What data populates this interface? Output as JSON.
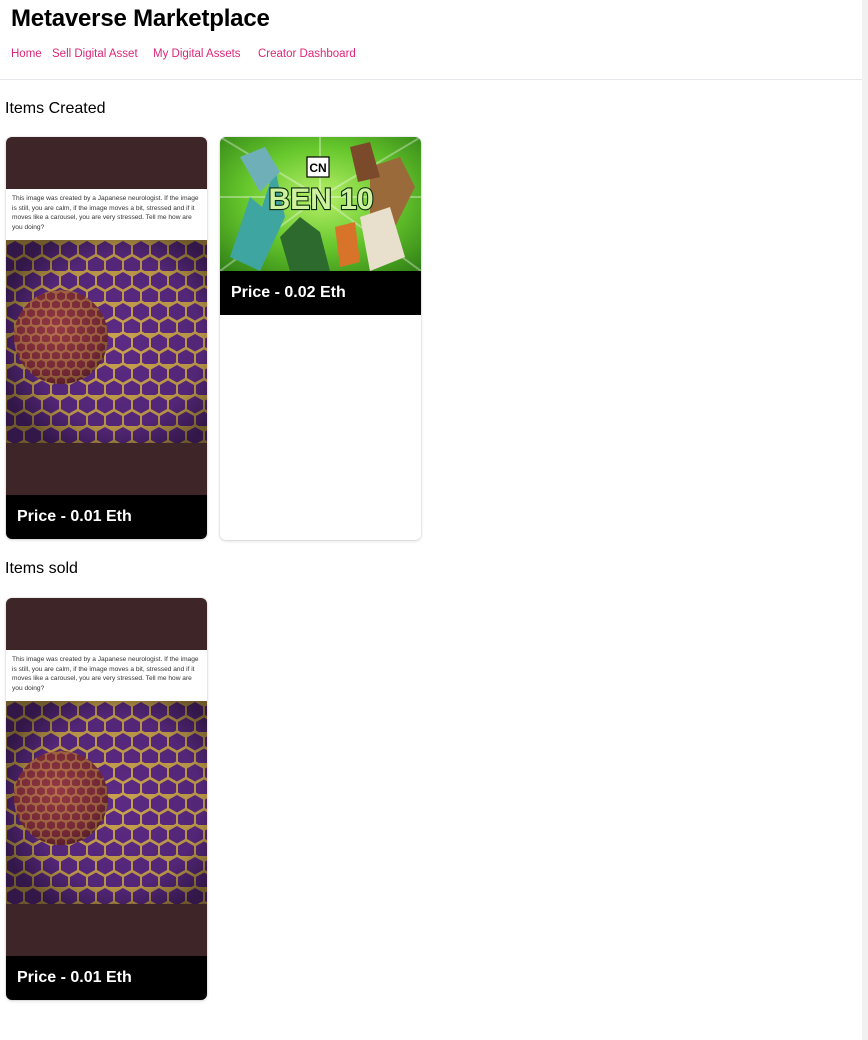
{
  "app": {
    "title": "Metaverse Marketplace",
    "nav": [
      {
        "label": "Home"
      },
      {
        "label": "Sell Digital Asset"
      },
      {
        "label": "My Digital Assets"
      },
      {
        "label": "Creator Dashboard"
      }
    ]
  },
  "sections": {
    "created": {
      "title": "Items Created",
      "items": [
        {
          "price_label": "Price - 0.01 Eth",
          "image_caption": "This image was created by a Japanese neurologist. If the image is still, you are calm, if the image moves a bit, stressed and if it moves like a carousel, you are very stressed. Tell me how are you doing?"
        },
        {
          "price_label": "Price - 0.02 Eth",
          "logo_top": "CN",
          "logo_main": "BEN 10"
        }
      ]
    },
    "sold": {
      "title": "Items sold",
      "items": [
        {
          "price_label": "Price - 0.01 Eth",
          "image_caption": "This image was created by a Japanese neurologist. If the image is still, you are calm, if the image moves a bit, stressed and if it moves like a carousel, you are very stressed. Tell me how are you doing?"
        }
      ]
    }
  },
  "colors": {
    "link": "#db2777",
    "price_bg": "#000000",
    "art_bg": "#3d2528",
    "hex_fill": "#5c2a84",
    "hex_stroke": "#c9a24e"
  }
}
